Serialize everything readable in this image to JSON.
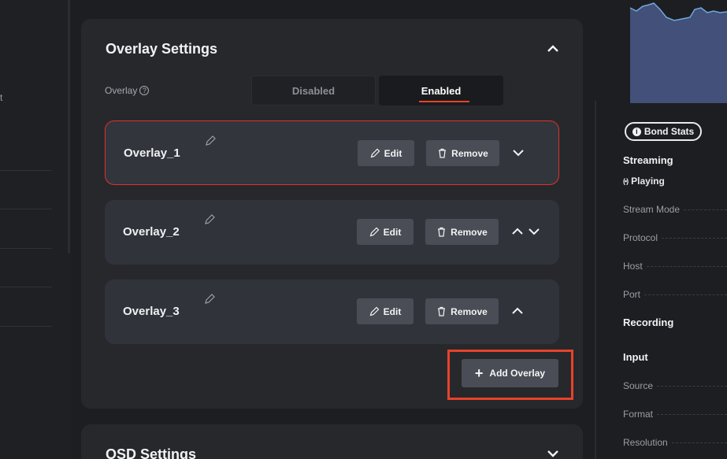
{
  "left_panel": {
    "fragment": "t"
  },
  "overlay_card": {
    "title": "Overlay Settings",
    "toggle_label": "Overlay",
    "help_glyph": "?",
    "options": {
      "disabled": "Disabled",
      "enabled": "Enabled"
    },
    "selected": "Enabled",
    "overlays": [
      {
        "name": "Overlay_1",
        "edit_label": "Edit",
        "remove_label": "Remove",
        "active": true
      },
      {
        "name": "Overlay_2",
        "edit_label": "Edit",
        "remove_label": "Remove",
        "active": false
      },
      {
        "name": "Overlay_3",
        "edit_label": "Edit",
        "remove_label": "Remove",
        "active": false
      }
    ],
    "add_label": "Add Overlay",
    "add_glyph": "+"
  },
  "osd_card": {
    "title": "OSD Settings"
  },
  "right_panel": {
    "stats_button": "Bond Stats",
    "info_glyph": "i",
    "streaming": {
      "title": "Streaming",
      "status": "Playing",
      "status_icon": "broadcast-icon",
      "status_glyph": "(•)"
    },
    "fields_streaming": [
      "Stream Mode",
      "Protocol",
      "Host",
      "Port"
    ],
    "recording_title": "Recording",
    "input_title": "Input",
    "fields_input": [
      "Source",
      "Format",
      "Resolution"
    ]
  },
  "colors": {
    "accent": "#e8422a",
    "active_border": "#e0322b",
    "card_bg": "#26282c",
    "row_bg": "#30333a",
    "button_bg": "#4a4d55",
    "graph_fill": "#42507a",
    "graph_line": "#6fa8dc"
  }
}
